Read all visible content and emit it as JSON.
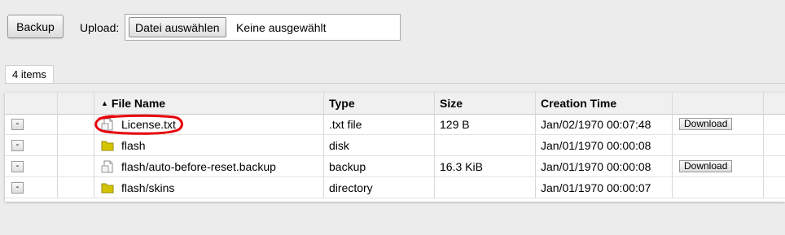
{
  "toolbar": {
    "backup_label": "Backup",
    "upload_label": "Upload:",
    "choose_file_label": "Datei auswählen",
    "no_file_label": "Keine ausgewählt"
  },
  "tab": {
    "label": "4 items"
  },
  "table": {
    "columns": [
      "File Name",
      "Type",
      "Size",
      "Creation Time"
    ],
    "sort_indicator": "▲",
    "remove_label": "-",
    "download_label": "Download",
    "rows": [
      {
        "name": "License.txt",
        "icon": "text-file-icon",
        "type": ".txt file",
        "size": "129 B",
        "created": "Jan/02/1970 00:07:48",
        "download": true
      },
      {
        "name": "flash",
        "icon": "folder-icon",
        "type": "disk",
        "size": "",
        "created": "Jan/01/1970 00:00:08",
        "download": false
      },
      {
        "name": "flash/auto-before-reset.backup",
        "icon": "text-file-icon",
        "type": "backup",
        "size": "16.3 KiB",
        "created": "Jan/01/1970 00:00:08",
        "download": true
      },
      {
        "name": "flash/skins",
        "icon": "folder-icon",
        "type": "directory",
        "size": "",
        "created": "Jan/01/1970 00:00:07",
        "download": false
      }
    ]
  },
  "colors": {
    "annotation": "#e8000b",
    "folder": "#d4c400",
    "background": "#ececec"
  }
}
